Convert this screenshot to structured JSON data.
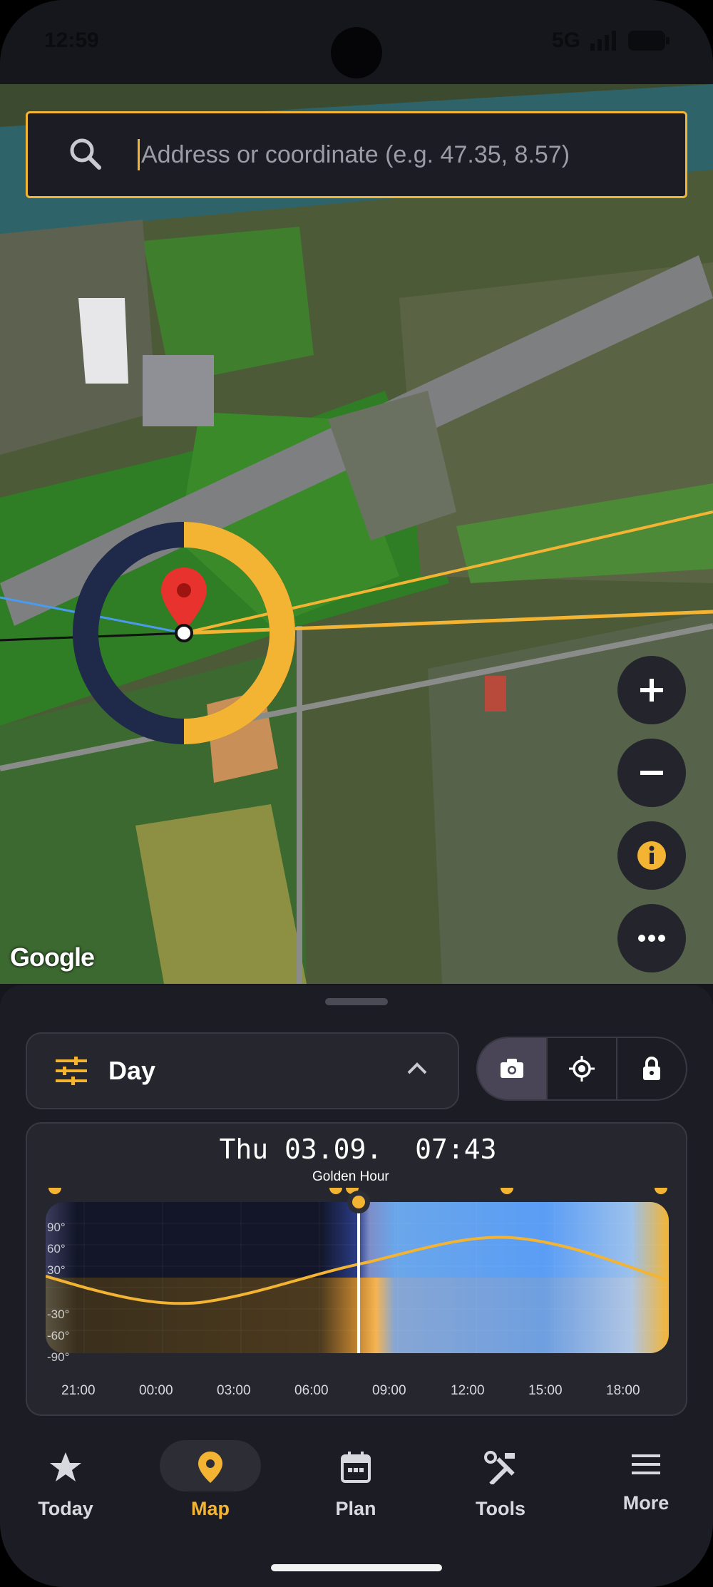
{
  "status": {
    "time": "12:59",
    "network": "5G"
  },
  "search": {
    "placeholder": "Address or coordinate (e.g. 47.35, 8.57)"
  },
  "map": {
    "attribution": "Google",
    "controls": [
      {
        "name": "zoom-in",
        "icon": "plus-icon"
      },
      {
        "name": "zoom-out",
        "icon": "minus-icon"
      },
      {
        "name": "info",
        "icon": "info-icon"
      },
      {
        "name": "more",
        "icon": "ellipsis-icon"
      }
    ]
  },
  "sheet": {
    "mode_label": "Day",
    "modes": [
      {
        "name": "camera",
        "icon": "camera-icon",
        "active": true
      },
      {
        "name": "locate",
        "icon": "crosshair-icon",
        "active": false
      },
      {
        "name": "lock",
        "icon": "lock-icon",
        "active": false
      }
    ],
    "timeline": {
      "date": "Thu 03.09.",
      "time": "07:43",
      "event_label": "Golden Hour",
      "degree_labels": [
        "90°",
        "60°",
        "30°",
        "-30°",
        "-60°",
        "-90°"
      ],
      "time_ticks": [
        "21:00",
        "00:00",
        "03:00",
        "06:00",
        "09:00",
        "12:00",
        "15:00",
        "18:00"
      ]
    }
  },
  "nav": {
    "items": [
      {
        "label": "Today",
        "icon": "star-icon"
      },
      {
        "label": "Map",
        "icon": "map-pin-icon",
        "active": true
      },
      {
        "label": "Plan",
        "icon": "calendar-icon"
      },
      {
        "label": "Tools",
        "icon": "tools-icon"
      },
      {
        "label": "More",
        "icon": "menu-icon"
      }
    ]
  },
  "colors": {
    "accent": "#f4b433",
    "background": "#1c1d24",
    "night": "#1f2a4a",
    "day": "#5a9df5"
  }
}
